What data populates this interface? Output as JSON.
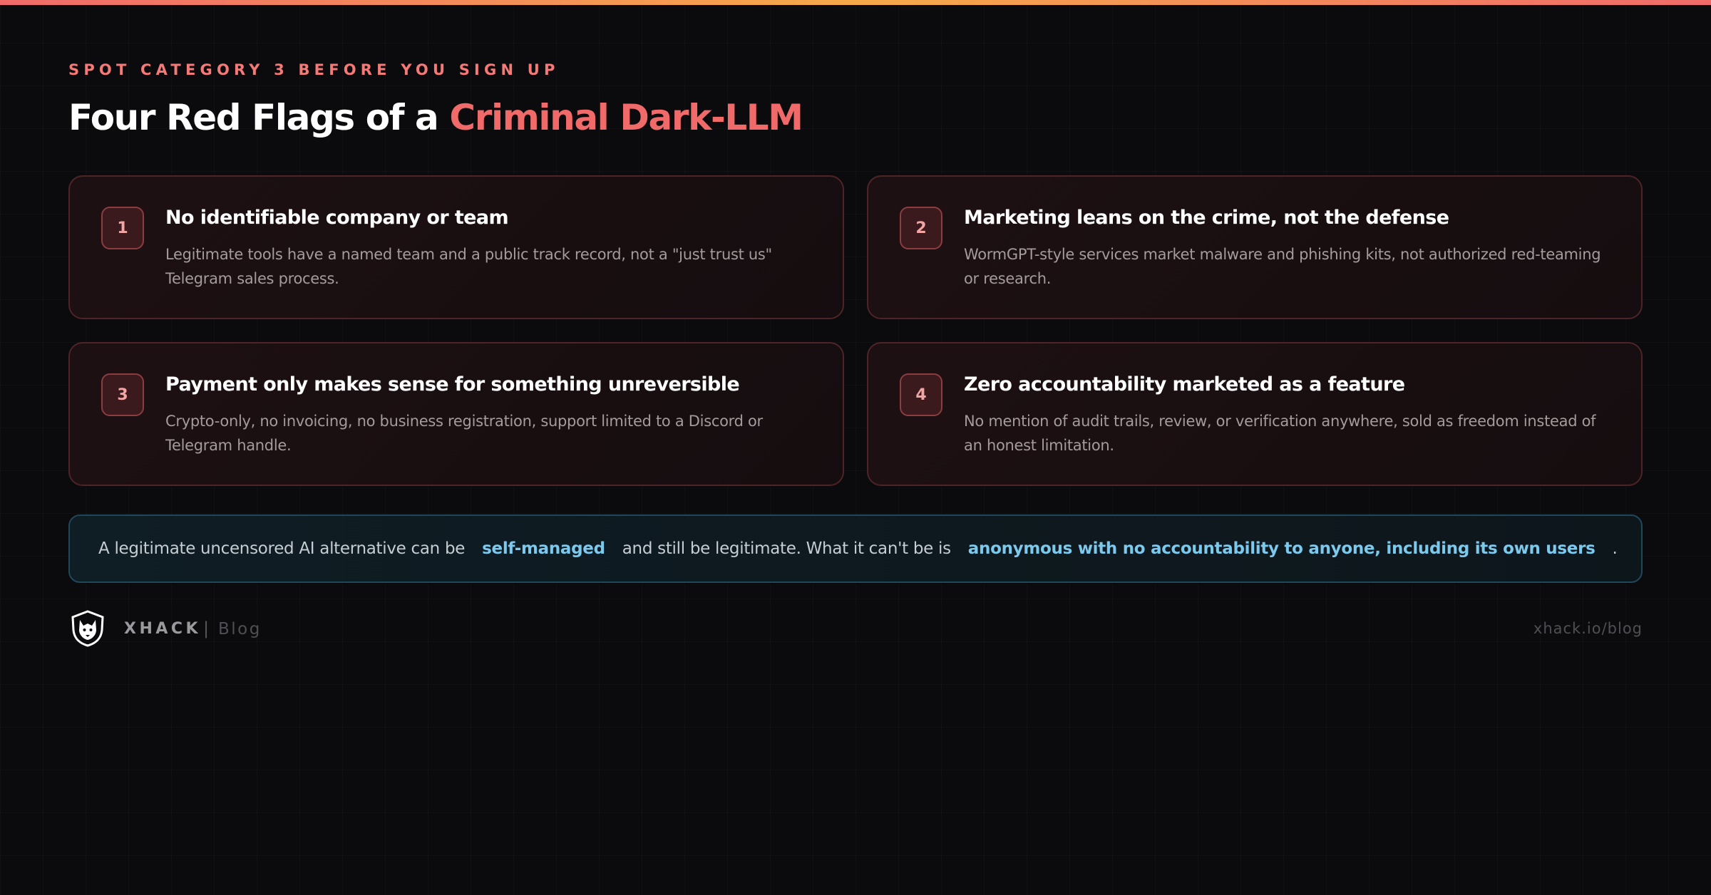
{
  "header": {
    "eyebrow": "SPOT CATEGORY 3 BEFORE YOU SIGN UP",
    "title_prefix": "Four Red Flags of a ",
    "title_accent": "Criminal Dark-LLM"
  },
  "flags": [
    {
      "number": "1",
      "title": "No identifiable company or team",
      "description": "Legitimate tools have a named team and a public track record, not a \"just trust us\" Telegram sales process."
    },
    {
      "number": "2",
      "title": "Marketing leans on the crime, not the defense",
      "description": "WormGPT-style services market malware and phishing kits, not authorized red-teaming or research."
    },
    {
      "number": "3",
      "title": "Payment only makes sense for something unreversible",
      "description": "Crypto-only, no invoicing, no business registration, support limited to a Discord or Telegram handle."
    },
    {
      "number": "4",
      "title": "Zero accountability marketed as a feature",
      "description": "No mention of audit trails, review, or verification anywhere, sold as freedom instead of an honest limitation."
    }
  ],
  "note": {
    "part1": "A legitimate uncensored AI alternative can be",
    "highlight1": "self-managed",
    "part2": "and still be legitimate. What it can't be is",
    "highlight2": "anonymous with no accountability to anyone, including its own users",
    "part3": "."
  },
  "footer": {
    "logo_icon": "wolf-shield-icon",
    "brand": "XHACK",
    "separator": "|",
    "section": "Blog",
    "url": "xhack.io/blog"
  },
  "colors": {
    "accent_red": "#f06a6a",
    "accent_blue": "#7cc9ee",
    "background": "#0b0b0d"
  }
}
